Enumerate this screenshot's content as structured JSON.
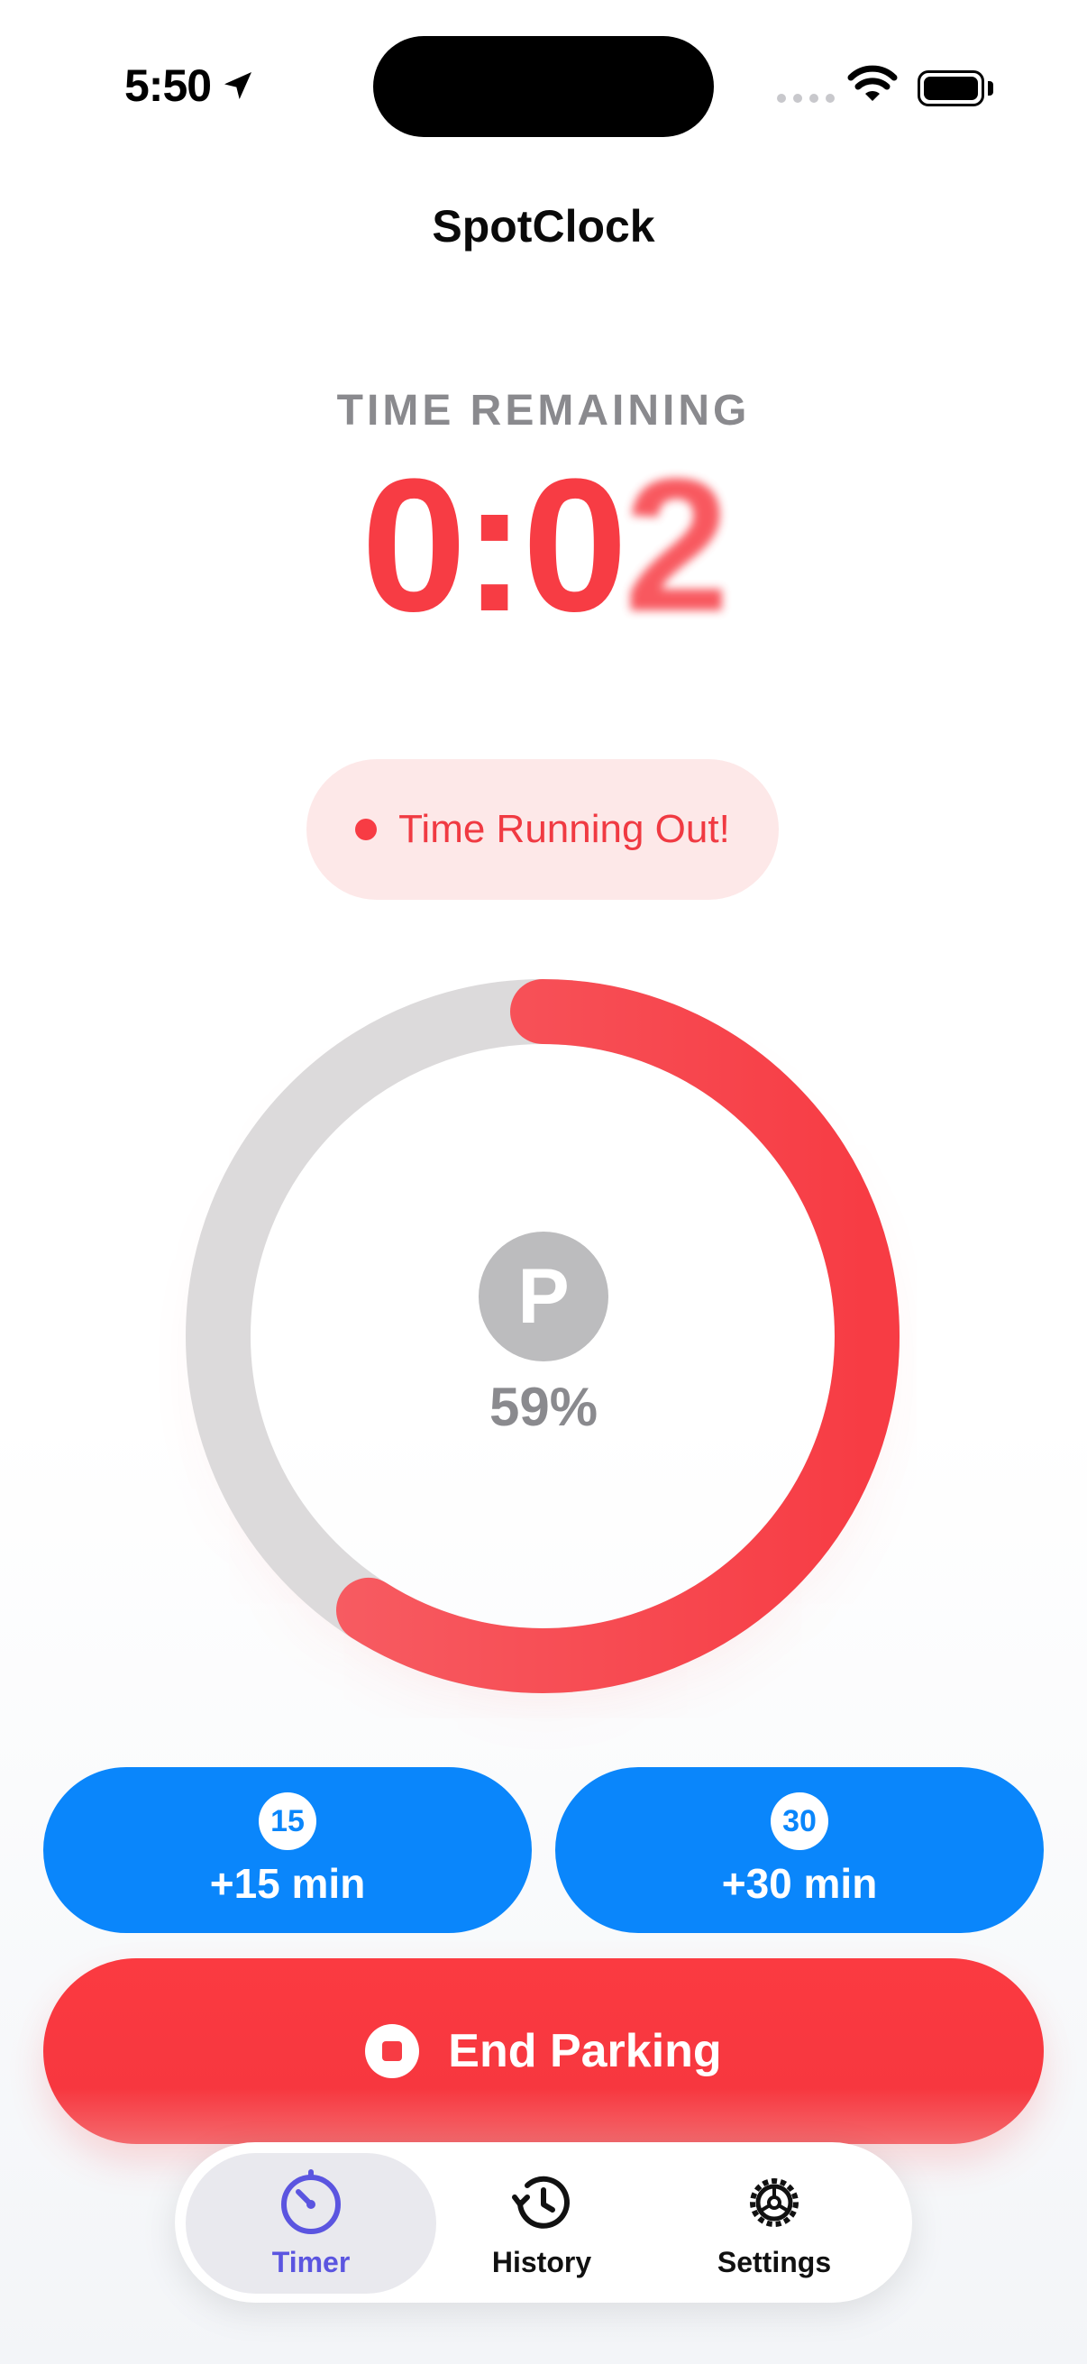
{
  "status_bar": {
    "time": "5:50",
    "location_icon": "location-arrow-icon",
    "wifi_icon": "wifi-icon",
    "battery_icon": "battery-icon"
  },
  "app": {
    "title": "SpotClock"
  },
  "timer": {
    "label": "TIME REMAINING",
    "value_main": "0:0",
    "value_last_digit": "2",
    "accent_color": "#f73c44"
  },
  "warning": {
    "text": "Time Running Out!"
  },
  "progress": {
    "percent_text": "59%",
    "fraction": 0.59,
    "badge_letter": "P",
    "track_color": "#dcdadb",
    "progress_color": "#f73c44"
  },
  "actions": {
    "extend_15": {
      "badge": "15",
      "label": "+15 min"
    },
    "extend_30": {
      "badge": "30",
      "label": "+30 min"
    },
    "end_parking": {
      "label": "End Parking",
      "icon": "stop-circle-icon"
    },
    "primary_color": "#0a86fb"
  },
  "tabs": [
    {
      "label": "Timer",
      "icon": "timer-icon",
      "selected": true
    },
    {
      "label": "History",
      "icon": "history-icon",
      "selected": false
    },
    {
      "label": "Settings",
      "icon": "gear-icon",
      "selected": false
    }
  ]
}
